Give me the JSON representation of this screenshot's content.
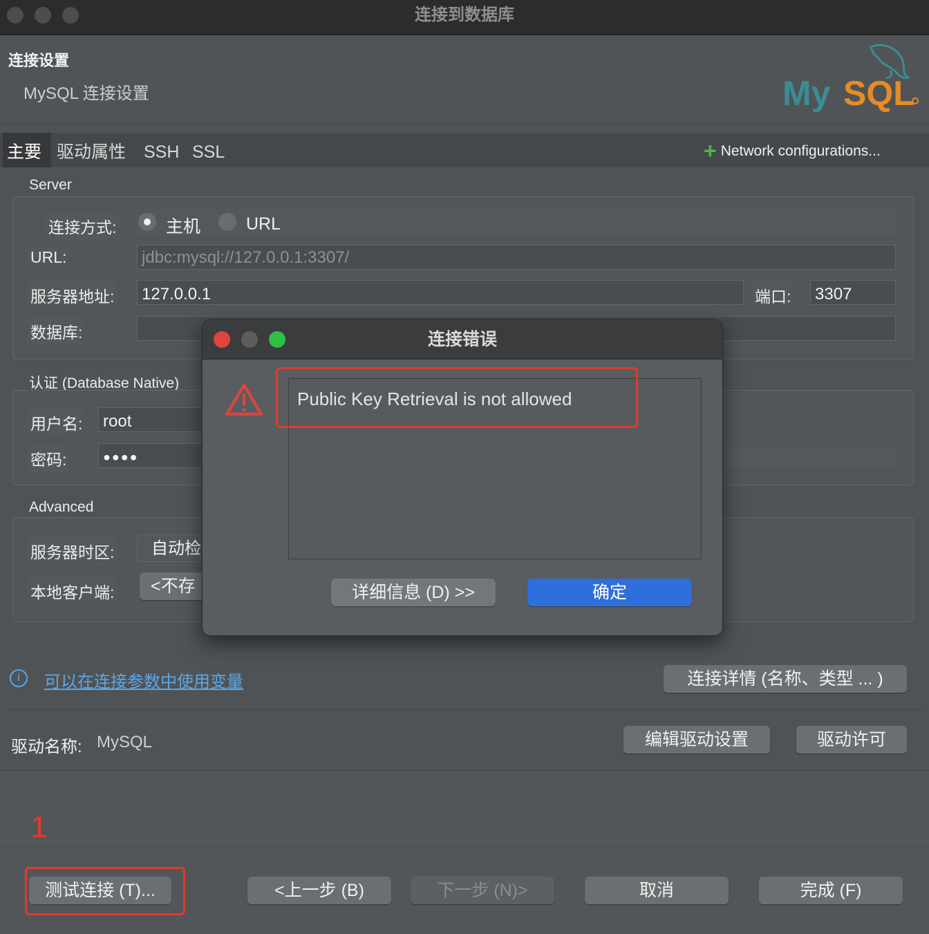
{
  "window": {
    "title": "连接到数据库"
  },
  "header": {
    "title": "连接设置",
    "subtitle": "MySQL 连接设置",
    "logo_text": "MySQL"
  },
  "tabs": [
    {
      "label": "主要",
      "active": true
    },
    {
      "label": "驱动属性",
      "active": false
    },
    {
      "label": "SSH",
      "active": false
    },
    {
      "label": "SSL",
      "active": false
    }
  ],
  "network_config": {
    "label": "Network configurations..."
  },
  "server": {
    "title": "Server",
    "connect_method_label": "连接方式:",
    "option_host": "主机",
    "option_url": "URL",
    "selected": "主机",
    "url_label": "URL:",
    "url_value": "jdbc:mysql://127.0.0.1:3307/",
    "host_label": "服务器地址:",
    "host_value": "127.0.0.1",
    "port_label": "端口:",
    "port_value": "3307",
    "db_label": "数据库:",
    "db_value": ""
  },
  "auth": {
    "title": "认证 (Database Native)",
    "user_label": "用户名:",
    "user_value": "root",
    "password_label": "密码:",
    "password_value": "●●●●"
  },
  "advanced": {
    "title": "Advanced",
    "timezone_label": "服务器时区:",
    "timezone_value": "自动检",
    "client_label": "本地客户端:",
    "client_value": "<不存"
  },
  "info_link": "可以在连接参数中使用变量",
  "details_button": "连接详情 (名称、类型 ... )",
  "driver": {
    "label": "驱动名称:",
    "value": "MySQL",
    "edit_button": "编辑驱动设置",
    "license_button": "驱动许可"
  },
  "annotation_number": "1",
  "footer": {
    "test_button": "测试连接 (T)...",
    "back_button": "<上一步 (B)",
    "next_button": "下一步 (N)>",
    "cancel_button": "取消",
    "finish_button": "完成 (F)"
  },
  "dialog": {
    "title": "连接错误",
    "message": "Public Key Retrieval is not allowed",
    "details_button": "详细信息 (D) >>",
    "ok_button": "确定"
  },
  "colors": {
    "accent_blue": "#2f6fdc",
    "annotation_red": "#e33a2e",
    "mysql_teal": "#3a8d95",
    "mysql_orange": "#e48d26",
    "plus_green": "#56b34a",
    "warning_red": "#e0443e",
    "link_blue": "#5aa7e6"
  }
}
